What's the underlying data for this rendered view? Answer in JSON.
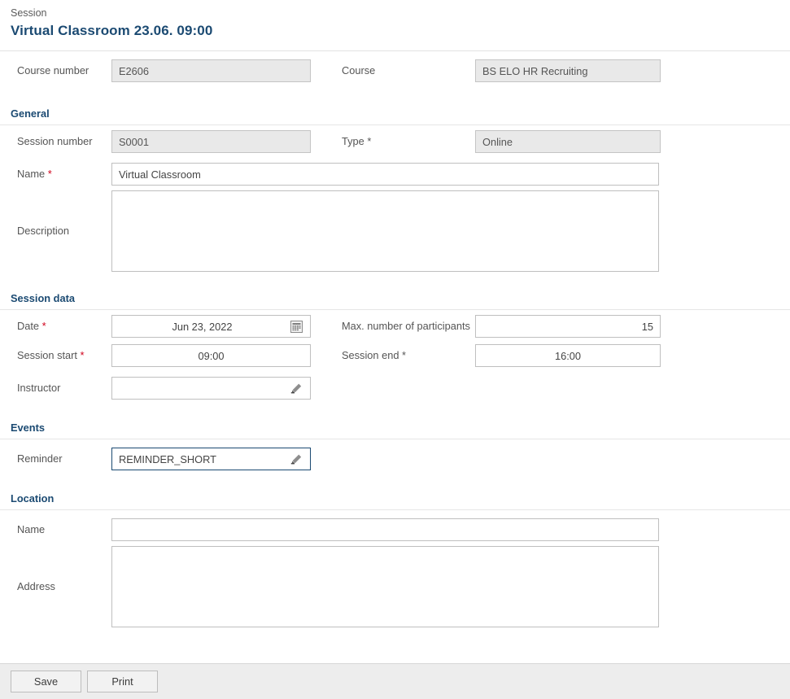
{
  "header": {
    "breadcrumb": "Session",
    "title": "Virtual Classroom 23.06. 09:00"
  },
  "top": {
    "course_number_label": "Course number",
    "course_number_value": "E2606",
    "course_label": "Course",
    "course_value": "BS ELO HR Recruiting"
  },
  "general": {
    "heading": "General",
    "session_number_label": "Session number",
    "session_number_value": "S0001",
    "type_label": "Type",
    "type_required": "*",
    "type_value": "Online",
    "name_label": "Name",
    "name_required": "*",
    "name_value": "Virtual Classroom",
    "description_label": "Description",
    "description_value": ""
  },
  "session_data": {
    "heading": "Session data",
    "date_label": "Date",
    "date_required": "*",
    "date_value": "Jun 23, 2022",
    "max_participants_label": "Max. number of participants",
    "max_participants_value": "15",
    "session_start_label": "Session start",
    "session_start_required": "*",
    "session_start_value": "09:00",
    "session_end_label": "Session end",
    "session_end_required": "*",
    "session_end_value": "16:00",
    "instructor_label": "Instructor",
    "instructor_value": ""
  },
  "events": {
    "heading": "Events",
    "reminder_label": "Reminder",
    "reminder_value": "REMINDER_SHORT"
  },
  "location": {
    "heading": "Location",
    "name_label": "Name",
    "name_value": "",
    "address_label": "Address",
    "address_value": ""
  },
  "footer": {
    "save_label": "Save",
    "print_label": "Print"
  },
  "icons": {
    "calendar": "calendar-icon",
    "pencil": "pencil-icon"
  },
  "colors": {
    "accent": "#1b4a72",
    "required": "#d0021b",
    "readonly_bg": "#e9e9e9",
    "footer_bg": "#ededed"
  }
}
